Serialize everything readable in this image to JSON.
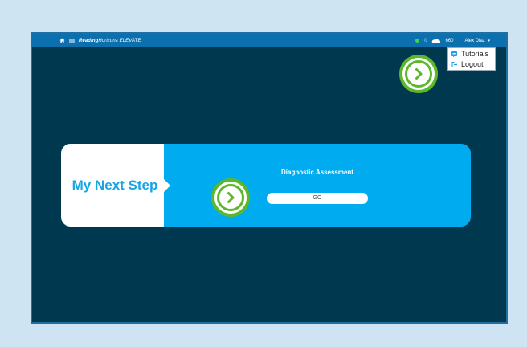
{
  "topbar": {
    "brand_bold": "Reading",
    "brand_rest": "Horizons ELEVATE",
    "status_count": "0",
    "cloud_value": "660",
    "user_name": "Alex Diaz",
    "caret": "▾"
  },
  "dropdown": {
    "items": [
      {
        "label": "Tutorials",
        "icon": "tutorials-icon"
      },
      {
        "label": "Logout",
        "icon": "logout-icon"
      }
    ]
  },
  "step": {
    "title": "My Next Step",
    "assessment_label": "Diagnostic Assessment",
    "go_label": "GO"
  },
  "colors": {
    "background": "#cfe4f2",
    "frame": "#00384f",
    "topbar": "#0b70ad",
    "accent": "#00abf0",
    "hint": "#5bb82a"
  }
}
